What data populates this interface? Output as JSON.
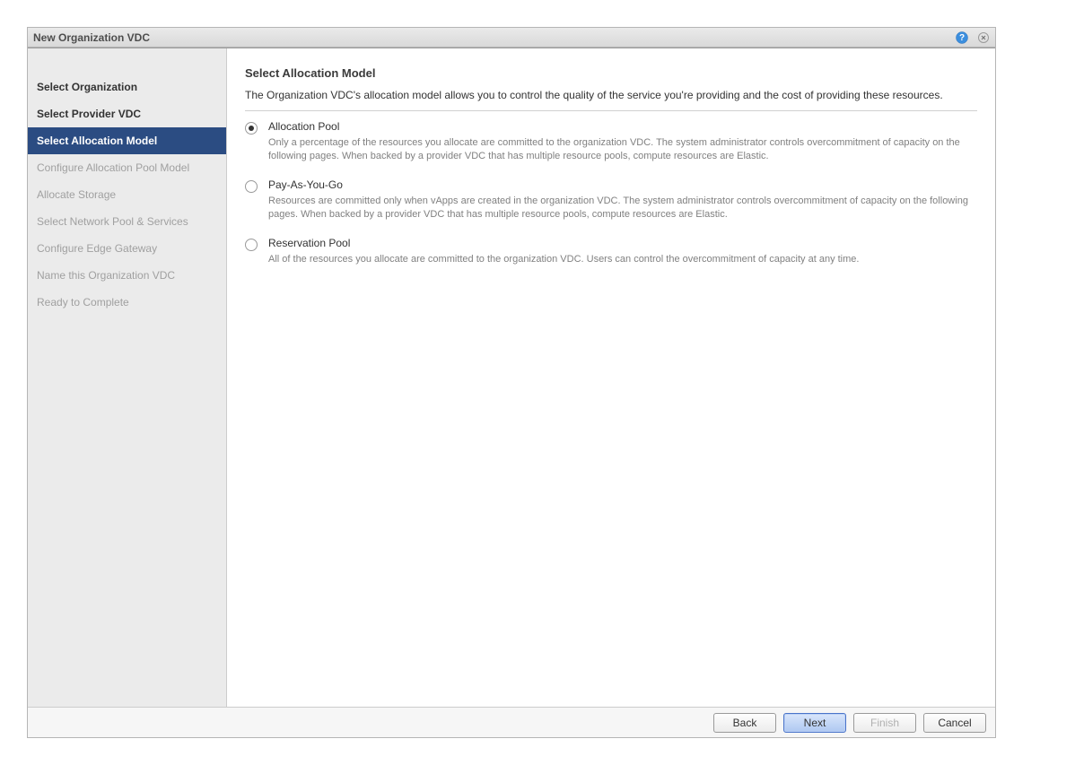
{
  "dialog": {
    "title": "New Organization VDC"
  },
  "sidebar": {
    "items": [
      {
        "label": "Select Organization",
        "state": "completed"
      },
      {
        "label": "Select Provider VDC",
        "state": "completed"
      },
      {
        "label": "Select Allocation Model",
        "state": "active"
      },
      {
        "label": "Configure Allocation Pool Model",
        "state": "pending"
      },
      {
        "label": "Allocate Storage",
        "state": "pending"
      },
      {
        "label": "Select Network Pool & Services",
        "state": "pending"
      },
      {
        "label": "Configure Edge Gateway",
        "state": "pending"
      },
      {
        "label": "Name this Organization VDC",
        "state": "pending"
      },
      {
        "label": "Ready to Complete",
        "state": "pending"
      }
    ]
  },
  "content": {
    "title": "Select Allocation Model",
    "intro": "The Organization VDC's allocation model allows you to control the quality of the service you're providing and the cost of providing these resources.",
    "options": [
      {
        "title": "Allocation Pool",
        "description": "Only a percentage of the resources you allocate are committed to the organization VDC. The system administrator controls overcommitment of capacity on the following pages. When backed by a provider VDC that has multiple resource pools, compute resources are Elastic.",
        "selected": true
      },
      {
        "title": "Pay-As-You-Go",
        "description": "Resources are committed only when vApps are created in the organization VDC. The system administrator controls overcommitment of capacity on the following pages. When backed by a provider VDC that has multiple resource pools, compute resources are Elastic.",
        "selected": false
      },
      {
        "title": "Reservation Pool",
        "description": "All of the resources you allocate are committed to the organization VDC. Users can control the overcommitment of capacity at any time.",
        "selected": false
      }
    ]
  },
  "footer": {
    "back": "Back",
    "next": "Next",
    "finish": "Finish",
    "cancel": "Cancel"
  }
}
